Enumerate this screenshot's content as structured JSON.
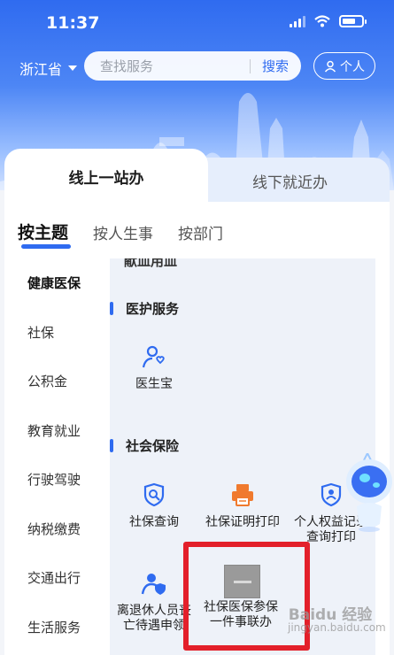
{
  "status_bar": {
    "time": "11:37"
  },
  "header": {
    "region": "浙江省",
    "search_placeholder": "查找服务",
    "search_button": "搜索",
    "personal_button": "个人"
  },
  "main_tabs": [
    {
      "label": "线上一站办",
      "active": true
    },
    {
      "label": "线下就近办",
      "active": false
    }
  ],
  "sub_tabs": [
    {
      "label": "按主题",
      "active": true
    },
    {
      "label": "按人生事",
      "active": false
    },
    {
      "label": "按部门",
      "active": false
    }
  ],
  "categories": [
    {
      "label": "健康医保",
      "active": true
    },
    {
      "label": "社保"
    },
    {
      "label": "公积金"
    },
    {
      "label": "教育就业"
    },
    {
      "label": "行驶驾驶"
    },
    {
      "label": "纳税缴费"
    },
    {
      "label": "交通出行"
    },
    {
      "label": "生活服务"
    }
  ],
  "content": {
    "cut_section_title": "献血用血",
    "sections": [
      {
        "title": "医护服务",
        "items": [
          {
            "label": "医生宝",
            "icon": "doctor-icon"
          }
        ]
      },
      {
        "title": "社会保险",
        "items": [
          {
            "label": "社保查询",
            "icon": "shield-search-icon"
          },
          {
            "label": "社保证明打印",
            "icon": "printer-icon"
          },
          {
            "label_line1": "个人权益记录",
            "label_line2": "查询打印",
            "icon": "shield-person-icon"
          },
          {
            "label_line1": "离退休人员丧",
            "label_line2": "亡待遇申领",
            "icon": "person-shield-icon"
          },
          {
            "label_line1": "社保医保参保",
            "label_line2": "一件事联办",
            "icon": "thumbnail-image"
          }
        ]
      }
    ]
  },
  "watermark": {
    "line1": "Baidu 经验",
    "line2": "jingyan.baidu.com"
  },
  "colors": {
    "accent": "#2f6bf0",
    "highlight": "#e3202a",
    "printer": "#f07a2e"
  }
}
